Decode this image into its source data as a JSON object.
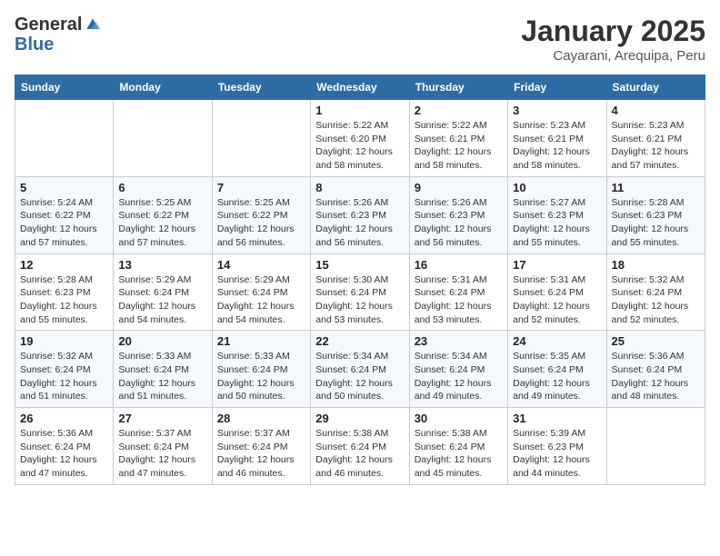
{
  "header": {
    "logo_line1": "General",
    "logo_line2": "Blue",
    "month": "January 2025",
    "location": "Cayarani, Arequipa, Peru"
  },
  "weekdays": [
    "Sunday",
    "Monday",
    "Tuesday",
    "Wednesday",
    "Thursday",
    "Friday",
    "Saturday"
  ],
  "weeks": [
    [
      {
        "day": "",
        "info": ""
      },
      {
        "day": "",
        "info": ""
      },
      {
        "day": "",
        "info": ""
      },
      {
        "day": "1",
        "info": "Sunrise: 5:22 AM\nSunset: 6:20 PM\nDaylight: 12 hours and 58 minutes."
      },
      {
        "day": "2",
        "info": "Sunrise: 5:22 AM\nSunset: 6:21 PM\nDaylight: 12 hours and 58 minutes."
      },
      {
        "day": "3",
        "info": "Sunrise: 5:23 AM\nSunset: 6:21 PM\nDaylight: 12 hours and 58 minutes."
      },
      {
        "day": "4",
        "info": "Sunrise: 5:23 AM\nSunset: 6:21 PM\nDaylight: 12 hours and 57 minutes."
      }
    ],
    [
      {
        "day": "5",
        "info": "Sunrise: 5:24 AM\nSunset: 6:22 PM\nDaylight: 12 hours and 57 minutes."
      },
      {
        "day": "6",
        "info": "Sunrise: 5:25 AM\nSunset: 6:22 PM\nDaylight: 12 hours and 57 minutes."
      },
      {
        "day": "7",
        "info": "Sunrise: 5:25 AM\nSunset: 6:22 PM\nDaylight: 12 hours and 56 minutes."
      },
      {
        "day": "8",
        "info": "Sunrise: 5:26 AM\nSunset: 6:23 PM\nDaylight: 12 hours and 56 minutes."
      },
      {
        "day": "9",
        "info": "Sunrise: 5:26 AM\nSunset: 6:23 PM\nDaylight: 12 hours and 56 minutes."
      },
      {
        "day": "10",
        "info": "Sunrise: 5:27 AM\nSunset: 6:23 PM\nDaylight: 12 hours and 55 minutes."
      },
      {
        "day": "11",
        "info": "Sunrise: 5:28 AM\nSunset: 6:23 PM\nDaylight: 12 hours and 55 minutes."
      }
    ],
    [
      {
        "day": "12",
        "info": "Sunrise: 5:28 AM\nSunset: 6:23 PM\nDaylight: 12 hours and 55 minutes."
      },
      {
        "day": "13",
        "info": "Sunrise: 5:29 AM\nSunset: 6:24 PM\nDaylight: 12 hours and 54 minutes."
      },
      {
        "day": "14",
        "info": "Sunrise: 5:29 AM\nSunset: 6:24 PM\nDaylight: 12 hours and 54 minutes."
      },
      {
        "day": "15",
        "info": "Sunrise: 5:30 AM\nSunset: 6:24 PM\nDaylight: 12 hours and 53 minutes."
      },
      {
        "day": "16",
        "info": "Sunrise: 5:31 AM\nSunset: 6:24 PM\nDaylight: 12 hours and 53 minutes."
      },
      {
        "day": "17",
        "info": "Sunrise: 5:31 AM\nSunset: 6:24 PM\nDaylight: 12 hours and 52 minutes."
      },
      {
        "day": "18",
        "info": "Sunrise: 5:32 AM\nSunset: 6:24 PM\nDaylight: 12 hours and 52 minutes."
      }
    ],
    [
      {
        "day": "19",
        "info": "Sunrise: 5:32 AM\nSunset: 6:24 PM\nDaylight: 12 hours and 51 minutes."
      },
      {
        "day": "20",
        "info": "Sunrise: 5:33 AM\nSunset: 6:24 PM\nDaylight: 12 hours and 51 minutes."
      },
      {
        "day": "21",
        "info": "Sunrise: 5:33 AM\nSunset: 6:24 PM\nDaylight: 12 hours and 50 minutes."
      },
      {
        "day": "22",
        "info": "Sunrise: 5:34 AM\nSunset: 6:24 PM\nDaylight: 12 hours and 50 minutes."
      },
      {
        "day": "23",
        "info": "Sunrise: 5:34 AM\nSunset: 6:24 PM\nDaylight: 12 hours and 49 minutes."
      },
      {
        "day": "24",
        "info": "Sunrise: 5:35 AM\nSunset: 6:24 PM\nDaylight: 12 hours and 49 minutes."
      },
      {
        "day": "25",
        "info": "Sunrise: 5:36 AM\nSunset: 6:24 PM\nDaylight: 12 hours and 48 minutes."
      }
    ],
    [
      {
        "day": "26",
        "info": "Sunrise: 5:36 AM\nSunset: 6:24 PM\nDaylight: 12 hours and 47 minutes."
      },
      {
        "day": "27",
        "info": "Sunrise: 5:37 AM\nSunset: 6:24 PM\nDaylight: 12 hours and 47 minutes."
      },
      {
        "day": "28",
        "info": "Sunrise: 5:37 AM\nSunset: 6:24 PM\nDaylight: 12 hours and 46 minutes."
      },
      {
        "day": "29",
        "info": "Sunrise: 5:38 AM\nSunset: 6:24 PM\nDaylight: 12 hours and 46 minutes."
      },
      {
        "day": "30",
        "info": "Sunrise: 5:38 AM\nSunset: 6:24 PM\nDaylight: 12 hours and 45 minutes."
      },
      {
        "day": "31",
        "info": "Sunrise: 5:39 AM\nSunset: 6:23 PM\nDaylight: 12 hours and 44 minutes."
      },
      {
        "day": "",
        "info": ""
      }
    ]
  ]
}
